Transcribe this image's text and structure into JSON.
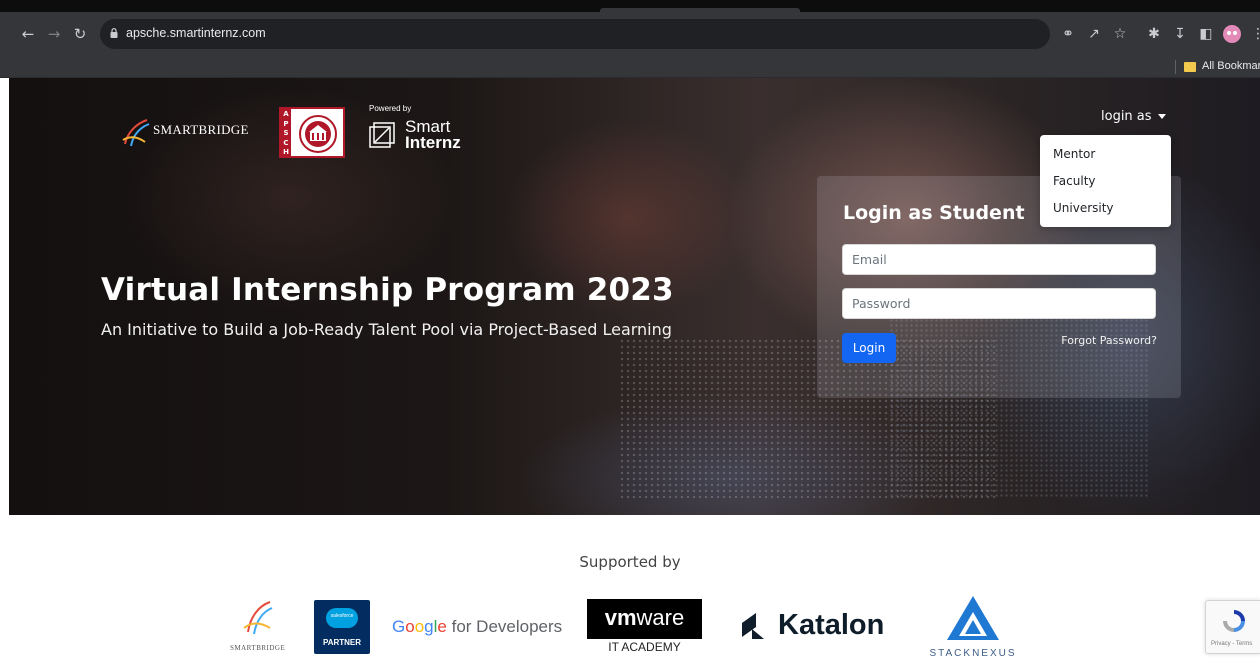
{
  "browser": {
    "url": "apsche.smartinternz.com",
    "bookmarks_label": "All Bookmarks"
  },
  "hero": {
    "powered_by": "Powered by",
    "smartbridge_name": "SMARTBRIDGE",
    "apsche_letters": [
      "A",
      "P",
      "S",
      "C",
      "H",
      "E"
    ],
    "smartinternz_line1": "Smart",
    "smartinternz_line2": "Internz",
    "title": "Virtual Internship Program 2023",
    "subtitle": "An Initiative to Build a Job-Ready Talent Pool via Project-Based Learning"
  },
  "login": {
    "title": "Login as Student",
    "email_placeholder": "Email",
    "password_placeholder": "Password",
    "login_button": "Login",
    "forgot_password": "Forgot Password?"
  },
  "login_as": {
    "toggle_label": "login as",
    "options": [
      "Mentor",
      "Faculty",
      "University"
    ]
  },
  "supported": {
    "heading": "Supported by",
    "smartbridge_caption": "SMARTBRIDGE",
    "salesforce_text": "salesforce",
    "salesforce_partner": "PARTNER",
    "google_word": [
      "G",
      "o",
      "o",
      "g",
      "l",
      "e"
    ],
    "google_rest": " for Developers",
    "vmware_bold": "vm",
    "vmware_rest": "ware",
    "vmware_caption": "IT ACADEMY",
    "katalon": "Katalon",
    "stacknexus": "STACKNEXUS"
  },
  "recaptcha": {
    "text": "Privacy - Terms"
  },
  "colors": {
    "primary_button": "#1266f1",
    "apsche_red": "#b0182a",
    "salesforce_blue": "#00a1e0"
  }
}
